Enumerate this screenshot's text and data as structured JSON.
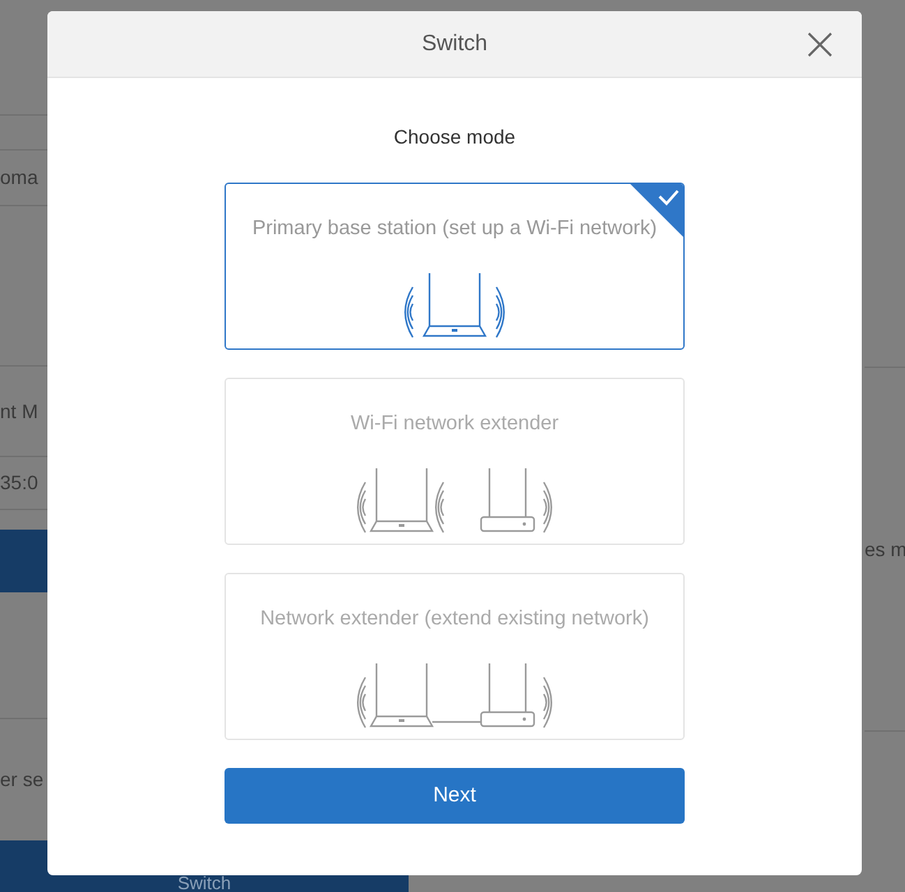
{
  "background": {
    "left_texts": [
      "oma",
      "nt M",
      "35:0",
      "er se"
    ],
    "right_texts": [
      "es m"
    ],
    "bottom_button": "Switch"
  },
  "dialog": {
    "title": "Switch",
    "heading": "Choose mode",
    "modes": [
      {
        "label": "Primary base station (set up a Wi-Fi network)",
        "kind": "router",
        "selected": true
      },
      {
        "label": "Wi-Fi network extender",
        "kind": "wireless-extender",
        "selected": false
      },
      {
        "label": "Network extender (extend existing network)",
        "kind": "wired-extender",
        "selected": false
      }
    ],
    "next_button": "Next"
  }
}
